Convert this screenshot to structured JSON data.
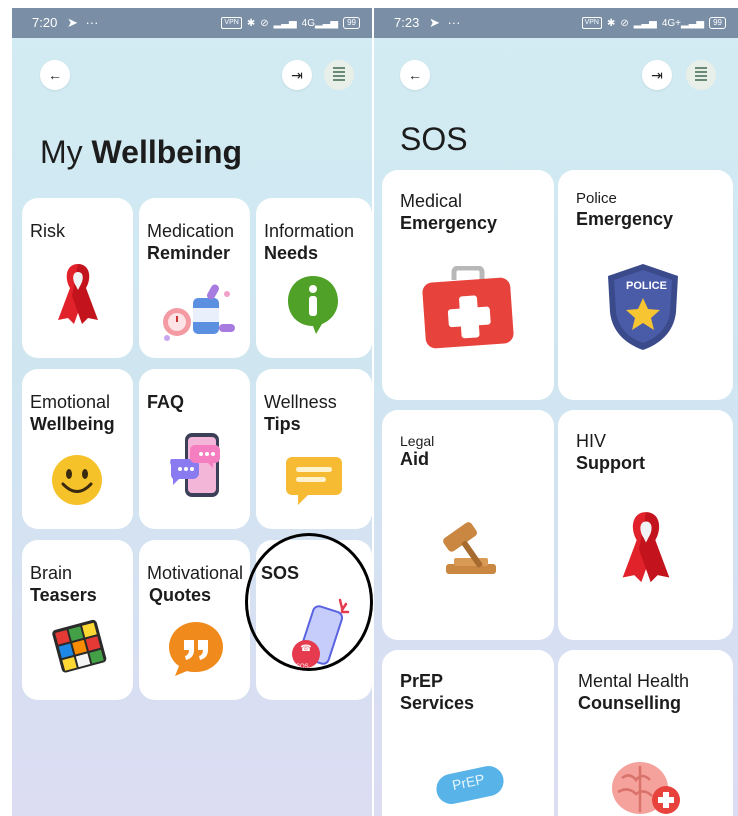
{
  "screen1": {
    "status_time": "7:20",
    "status_icons": [
      "navigation-arrow-icon",
      "more-dots-icon",
      "vpn-icon",
      "bluetooth-icon",
      "link-icon",
      "signal-icon",
      "4g-signal-icon",
      "battery-icon"
    ],
    "vpn_label": "VPN",
    "network_label": "4G",
    "battery_level": "99",
    "title_light": "My",
    "title_bold": "Wellbeing",
    "tiles": [
      {
        "line1": "Risk",
        "line2": "",
        "icon": "red-ribbon-icon"
      },
      {
        "line1": "Medication",
        "line2": "Reminder",
        "icon": "pills-clock-icon"
      },
      {
        "line1": "Information",
        "line2": "Needs",
        "icon": "info-bubble-icon"
      },
      {
        "line1": "Emotional",
        "line2": "Wellbeing",
        "icon": "smiley-face-icon"
      },
      {
        "line1": "",
        "line2": "FAQ",
        "icon": "chat-phone-icon"
      },
      {
        "line1": "Wellness",
        "line2": "Tips",
        "icon": "message-bubble-icon"
      },
      {
        "line1": "Brain",
        "line2": "Teasers",
        "icon": "rubiks-cube-icon"
      },
      {
        "line1": "Motivational",
        "line2": "Quotes",
        "icon": "quote-bubble-icon"
      },
      {
        "line1": "",
        "line2": "SOS",
        "icon": "sos-phone-icon",
        "badge": "SOS"
      }
    ]
  },
  "screen2": {
    "status_time": "7:23",
    "status_icons": [
      "navigation-arrow-icon",
      "more-dots-icon",
      "vpn-icon",
      "bluetooth-icon",
      "link-icon",
      "signal-icon",
      "4g-signal-icon",
      "battery-icon"
    ],
    "vpn_label": "VPN",
    "network_label": "4G+",
    "battery_level": "99",
    "title": "SOS",
    "tiles": [
      {
        "line1": "Medical",
        "line2": "Emergency",
        "icon": "first-aid-kit-icon"
      },
      {
        "line1": "Police",
        "line2": "Emergency",
        "icon": "police-badge-icon",
        "badge": "POLICE"
      },
      {
        "line1": "Legal",
        "line2": "Aid",
        "icon": "gavel-icon"
      },
      {
        "line1": "HIV",
        "line2": "Support",
        "icon": "red-ribbon-icon"
      },
      {
        "line1": "PrEP",
        "line2": "Services",
        "icon": "prep-pill-icon",
        "badge": "PrEP"
      },
      {
        "line1": "Mental Health",
        "line2": "Counselling",
        "icon": "brain-plus-icon"
      }
    ]
  },
  "colors": {
    "status_bar": "#7a8fa6",
    "ribbon": "#e2222b",
    "sos_accent": "#e63a4e",
    "info_green": "#4fa227",
    "quote_orange": "#f08a1c",
    "police_blue": "#3b4a8a",
    "prep_blue": "#58b4e8"
  }
}
